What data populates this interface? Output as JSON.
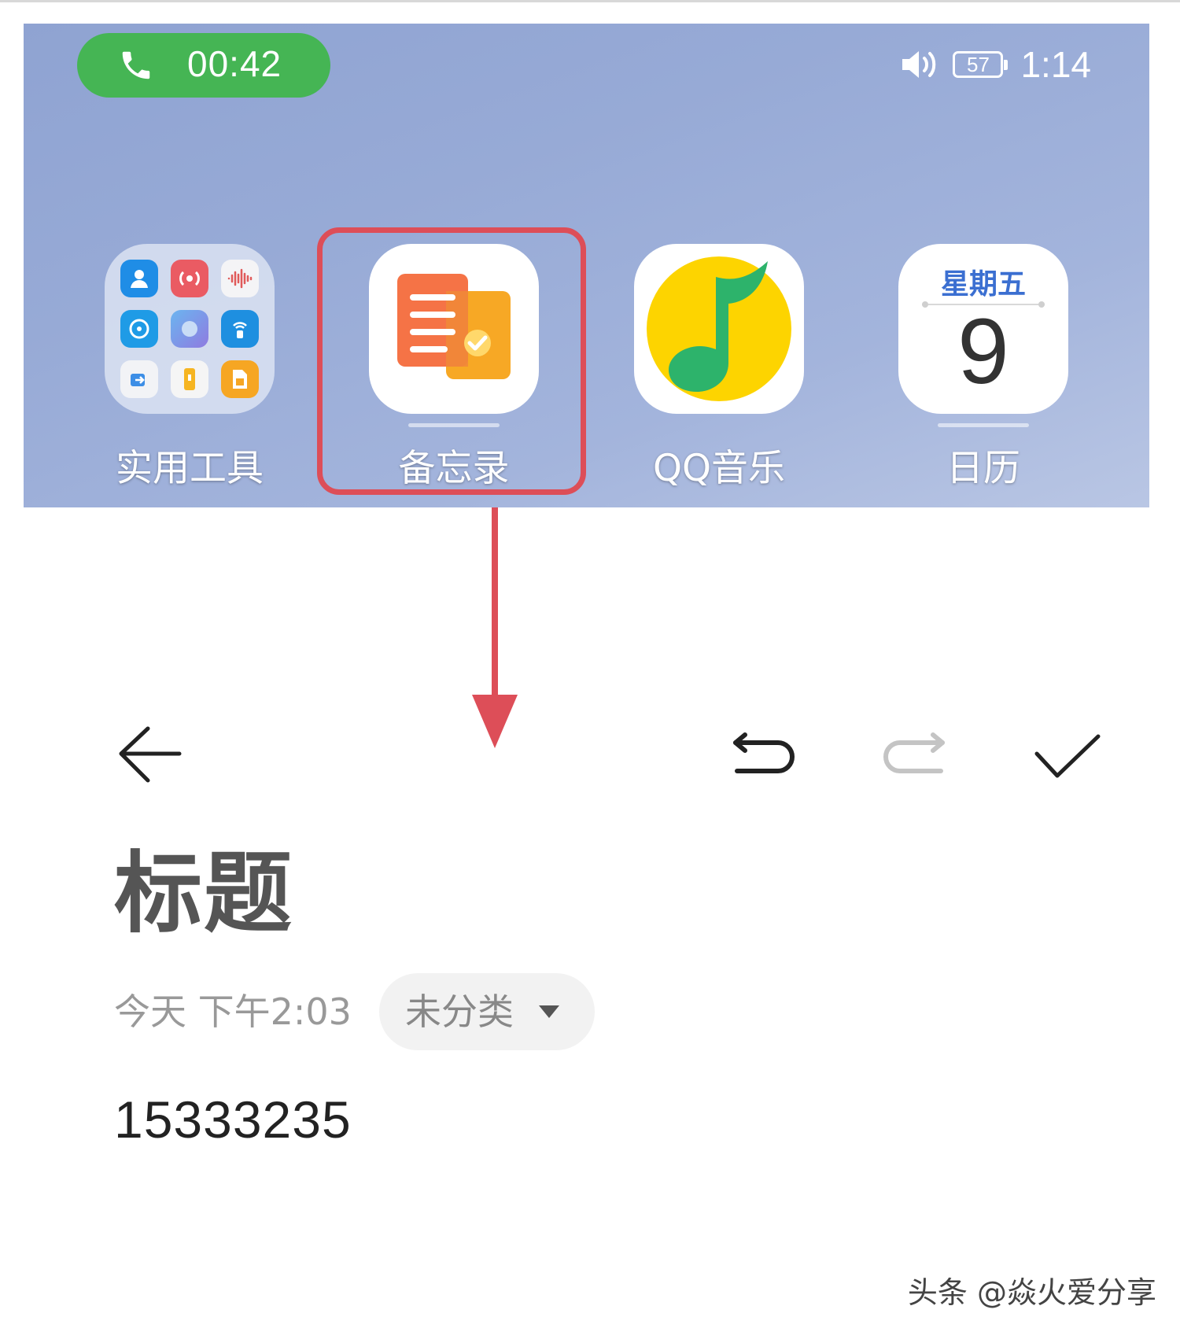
{
  "status_bar": {
    "call_timer": "00:42",
    "battery_level": "57",
    "clock": "1:14",
    "icons": [
      "phone-icon",
      "volume-icon",
      "battery-icon"
    ]
  },
  "apps": [
    {
      "label": "实用工具",
      "icon": "folder-icon"
    },
    {
      "label": "备忘录",
      "icon": "notepad-icon"
    },
    {
      "label": "QQ音乐",
      "icon": "music-note-icon"
    },
    {
      "label": "日历",
      "icon": "calendar-icon",
      "weekday": "星期五",
      "day": "9"
    }
  ],
  "highlight": {
    "target": "备忘录",
    "color": "#dd4e58"
  },
  "toolbar": {
    "icons": [
      "back-arrow-icon",
      "undo-icon",
      "redo-icon",
      "checkmark-icon"
    ]
  },
  "note": {
    "title": "标题",
    "date": "今天 下午2:03",
    "category": "未分类",
    "body": "15333235"
  },
  "watermark": "头条 @焱火爱分享",
  "colors": {
    "call_pill": "#45b554",
    "calendar_weekday": "#3b6fd1",
    "highlight_red": "#dd4e58"
  }
}
